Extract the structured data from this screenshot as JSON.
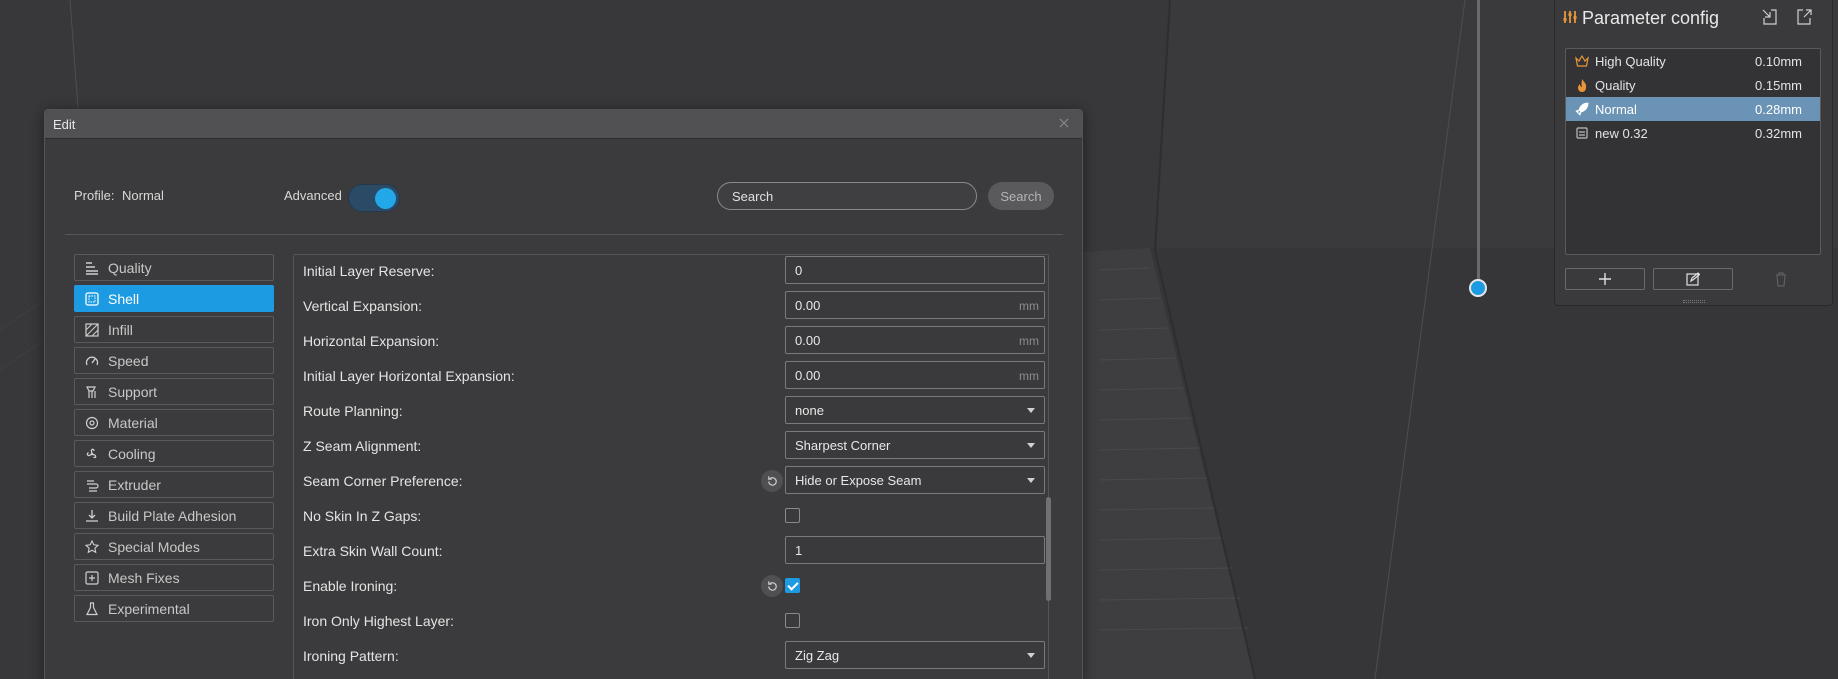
{
  "dialog": {
    "title": "Edit",
    "profile_label": "Profile:",
    "profile_value": "Normal",
    "advanced_label": "Advanced",
    "advanced_on": true,
    "search_value": "Search",
    "search_button": "Search"
  },
  "categories": [
    {
      "label": "Quality",
      "icon": "quality-icon",
      "active": false
    },
    {
      "label": "Shell",
      "icon": "shell-icon",
      "active": true
    },
    {
      "label": "Infill",
      "icon": "infill-icon",
      "active": false
    },
    {
      "label": "Speed",
      "icon": "speed-icon",
      "active": false
    },
    {
      "label": "Support",
      "icon": "support-icon",
      "active": false
    },
    {
      "label": "Material",
      "icon": "material-icon",
      "active": false
    },
    {
      "label": "Cooling",
      "icon": "cooling-fan-icon",
      "active": false
    },
    {
      "label": "Extruder",
      "icon": "extruder-icon",
      "active": false
    },
    {
      "label": "Build Plate Adhesion",
      "icon": "build-plate-icon",
      "active": false
    },
    {
      "label": "Special Modes",
      "icon": "star-icon",
      "active": false
    },
    {
      "label": "Mesh Fixes",
      "icon": "mesh-fix-icon",
      "active": false
    },
    {
      "label": "Experimental",
      "icon": "flask-icon",
      "active": false
    }
  ],
  "settings": [
    {
      "label": "Initial Layer Reserve:",
      "type": "text",
      "value": "0",
      "unit": "",
      "reset": false
    },
    {
      "label": "Vertical Expansion:",
      "type": "text",
      "value": "0.00",
      "unit": "mm",
      "reset": false
    },
    {
      "label": "Horizontal Expansion:",
      "type": "text",
      "value": "0.00",
      "unit": "mm",
      "reset": false
    },
    {
      "label": "Initial Layer Horizontal Expansion:",
      "type": "text",
      "value": "0.00",
      "unit": "mm",
      "reset": false
    },
    {
      "label": "Route Planning:",
      "type": "select",
      "value": "none",
      "unit": "",
      "reset": false
    },
    {
      "label": "Z Seam Alignment:",
      "type": "select",
      "value": "Sharpest Corner",
      "unit": "",
      "reset": false
    },
    {
      "label": "Seam Corner Preference:",
      "type": "select",
      "value": "Hide or Expose Seam",
      "unit": "",
      "reset": true
    },
    {
      "label": "No Skin In Z Gaps:",
      "type": "checkbox",
      "checked": false,
      "reset": false
    },
    {
      "label": "Extra Skin Wall Count:",
      "type": "text",
      "value": "1",
      "unit": "",
      "reset": false
    },
    {
      "label": "Enable Ironing:",
      "type": "checkbox",
      "checked": true,
      "reset": true
    },
    {
      "label": "Iron Only Highest Layer:",
      "type": "checkbox",
      "checked": false,
      "reset": false
    },
    {
      "label": "Ironing Pattern:",
      "type": "select",
      "value": "Zig Zag",
      "unit": "",
      "reset": false
    }
  ],
  "param_config": {
    "title": "Parameter config",
    "profiles": [
      {
        "name": "High Quality",
        "value": "0.10mm",
        "icon": "crown-icon",
        "active": false
      },
      {
        "name": "Quality",
        "value": "0.15mm",
        "icon": "flame-icon",
        "active": false
      },
      {
        "name": "Normal",
        "value": "0.28mm",
        "icon": "rocket-icon",
        "active": true
      },
      {
        "name": "new 0.32",
        "value": "0.32mm",
        "icon": "custom-profile-icon",
        "active": false
      }
    ]
  },
  "colors": {
    "accent": "#1d9be2",
    "selected_profile": "#6a93b5",
    "orange_icon": "#e8953a"
  }
}
